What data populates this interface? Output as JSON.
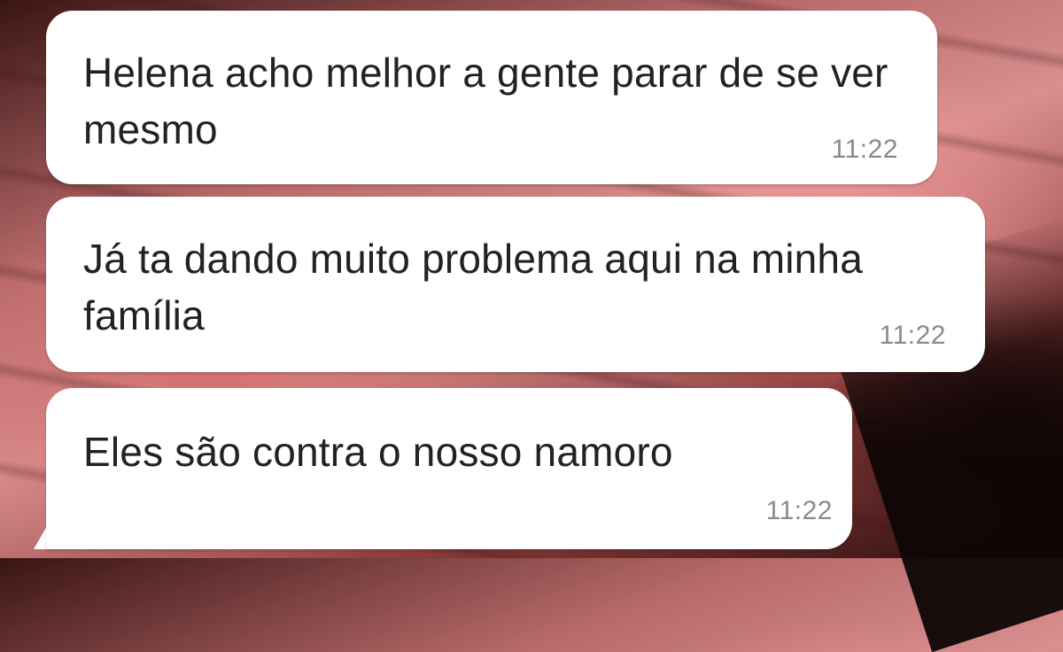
{
  "chat": {
    "messages": [
      {
        "text": "Helena acho melhor a gente parar de se ver mesmo",
        "time": "11:22"
      },
      {
        "text": "Já ta dando muito problema aqui na minha família",
        "time": "11:22"
      },
      {
        "text": "Eles são contra o nosso namoro",
        "time": "11:22"
      }
    ]
  }
}
